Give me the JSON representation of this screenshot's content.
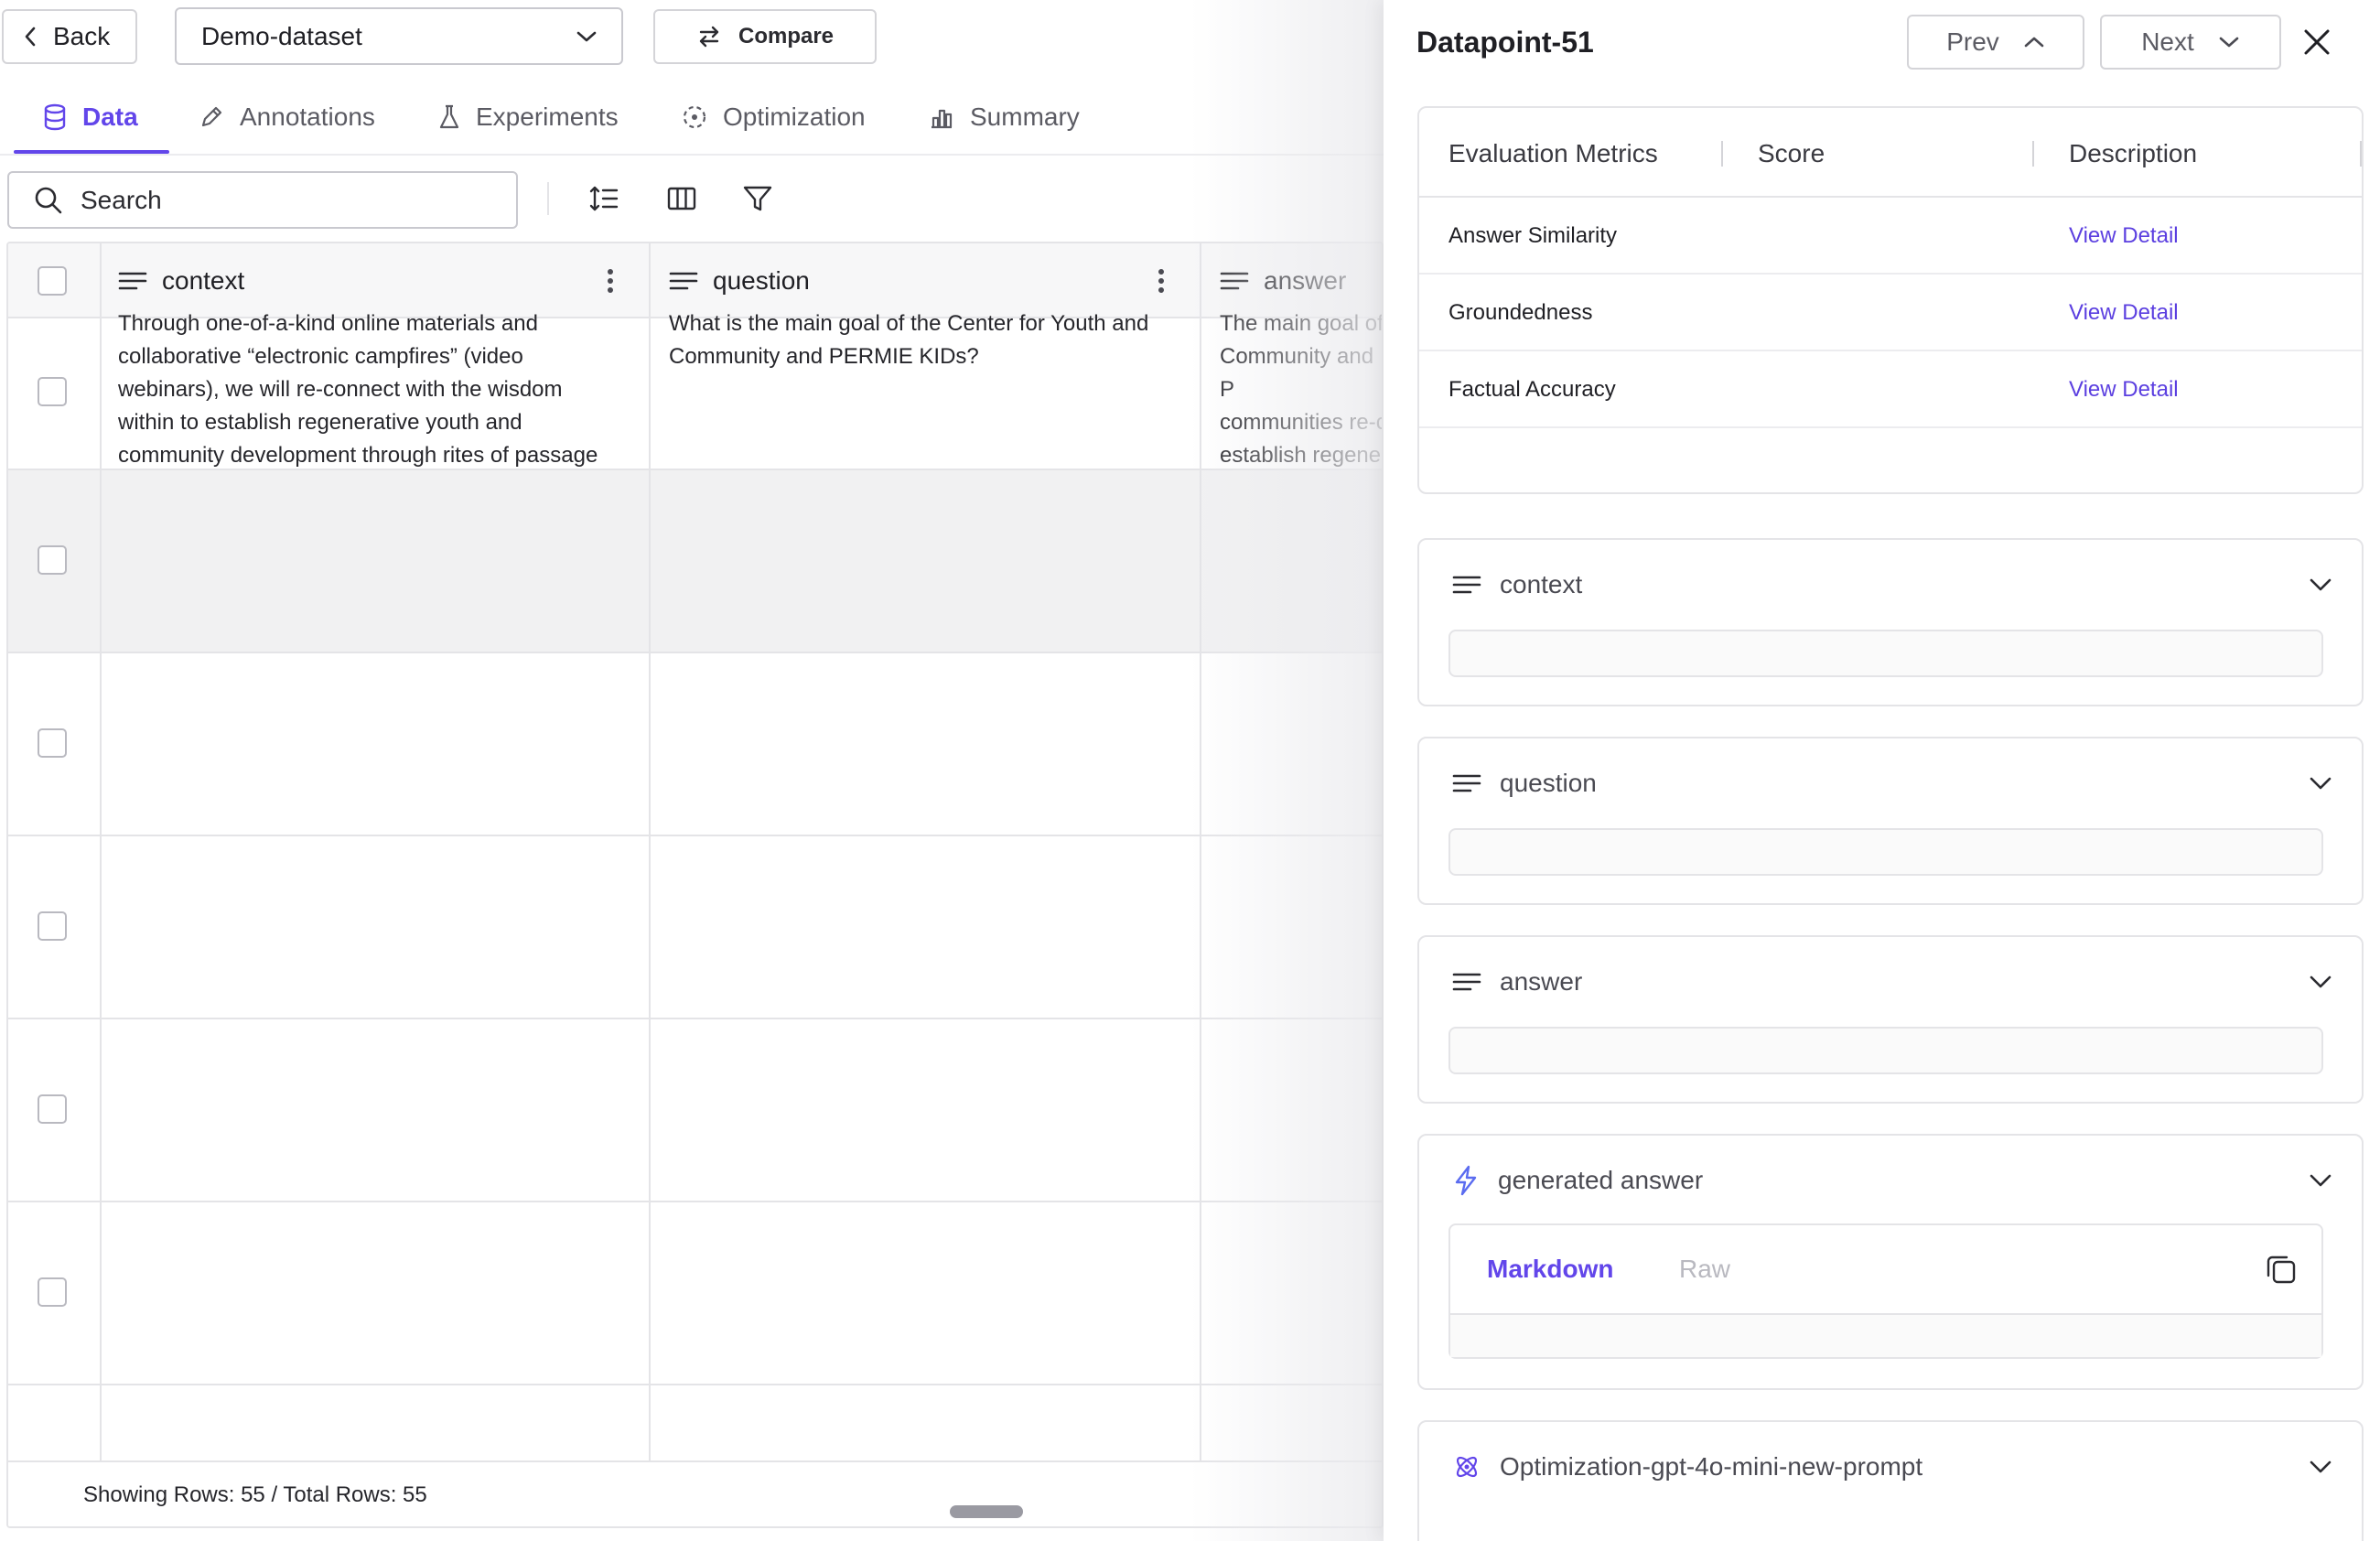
{
  "topbar": {
    "back_label": "Back",
    "dataset_value": "Demo-dataset",
    "compare_label": "Compare"
  },
  "tabs": [
    {
      "label": "Data",
      "icon": "database-icon",
      "active": true
    },
    {
      "label": "Annotations",
      "icon": "pencil-icon",
      "active": false
    },
    {
      "label": "Experiments",
      "icon": "flask-icon",
      "active": false
    },
    {
      "label": "Optimization",
      "icon": "optimization-icon",
      "active": false
    },
    {
      "label": "Summary",
      "icon": "bar-chart-icon",
      "active": false
    }
  ],
  "toolbar": {
    "search_placeholder": "Search",
    "icons": [
      "row-height-icon",
      "columns-icon",
      "filter-icon"
    ]
  },
  "grid": {
    "columns": [
      "context",
      "question",
      "answer"
    ],
    "rows": [
      {
        "context": "Through one-of-a-kind online materials and\ncollaborative “electronic campfires” (video\nwebinars), we will re-connect with the wisdom\nwithin to establish regenerative youth and\ncommunity development through rites of passage",
        "question": "What is the main goal of the Center for Youth and\nCommunity and PERMIE KIDs?",
        "answer": "The main goal of\nCommunity and P\ncommunities re-c\nestablish regener\ndevelopment thr"
      }
    ],
    "footer": "Showing Rows: 55 / Total Rows: 55"
  },
  "panel": {
    "title": "Datapoint-51",
    "prev_label": "Prev",
    "next_label": "Next",
    "metrics_headers": [
      "Evaluation Metrics",
      "Score",
      "Description"
    ],
    "metrics": [
      {
        "name": "Answer Similarity",
        "score": "",
        "link": "View Detail"
      },
      {
        "name": "Groundedness",
        "score": "",
        "link": "View Detail"
      },
      {
        "name": "Factual Accuracy",
        "score": "",
        "link": "View Detail"
      }
    ],
    "fields": [
      {
        "label": "context",
        "icon": "text-lines-icon"
      },
      {
        "label": "question",
        "icon": "text-lines-icon"
      },
      {
        "label": "answer",
        "icon": "text-lines-icon"
      }
    ],
    "generated": {
      "label": "generated answer",
      "icon": "lightning-icon",
      "tab_markdown": "Markdown",
      "tab_raw": "Raw"
    },
    "optimization": {
      "label": "Optimization-gpt-4o-mini-new-prompt",
      "icon": "atom-icon"
    }
  },
  "colors": {
    "accent": "#6246ea",
    "link": "#5b3fe0",
    "border": "#e4e4e7"
  }
}
